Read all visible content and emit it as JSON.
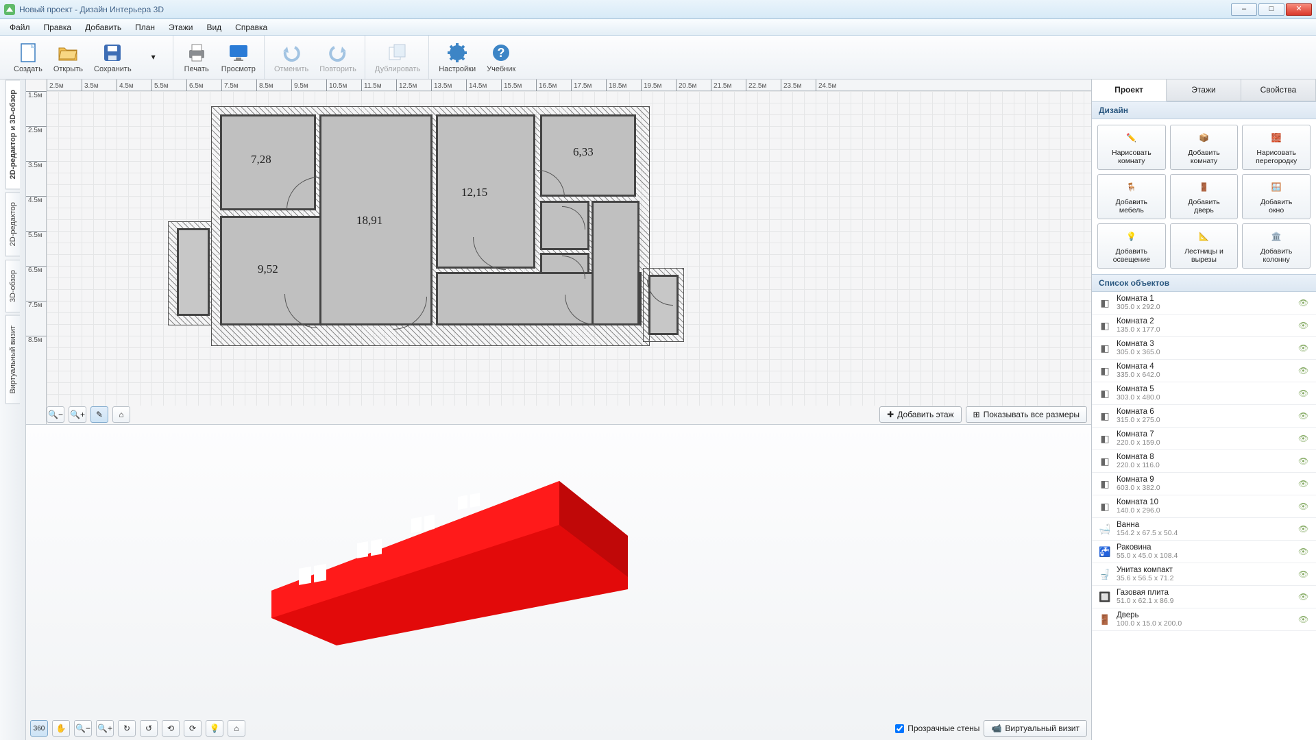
{
  "window": {
    "title": "Новый проект - Дизайн Интерьера 3D"
  },
  "menu": {
    "items": [
      "Файл",
      "Правка",
      "Добавить",
      "План",
      "Этажи",
      "Вид",
      "Справка"
    ]
  },
  "toolbar": {
    "create": "Создать",
    "open": "Открыть",
    "save": "Сохранить",
    "print": "Печать",
    "view": "Просмотр",
    "undo": "Отменить",
    "redo": "Повторить",
    "duplicate": "Дублировать",
    "settings": "Настройки",
    "tutorial": "Учебник"
  },
  "left_tabs": {
    "combo": "2D-редактор и 3D-обзор",
    "editor": "2D-редактор",
    "overview": "3D-обзор",
    "virtual": "Виртуальный визит"
  },
  "ruler_h": [
    "2.5м",
    "3.5м",
    "4.5м",
    "5.5м",
    "6.5м",
    "7.5м",
    "8.5м",
    "9.5м",
    "10.5м",
    "11.5м",
    "12.5м",
    "13.5м",
    "14.5м",
    "15.5м",
    "16.5м",
    "17.5м",
    "18.5м",
    "19.5м",
    "20.5м",
    "21.5м",
    "22.5м",
    "23.5м",
    "24.5м"
  ],
  "ruler_v": [
    "1.5м",
    "2.5м",
    "3.5м",
    "4.5м",
    "5.5м",
    "6.5м",
    "7.5м",
    "8.5м"
  ],
  "rooms": {
    "r1": "7,28",
    "r2": "18,91",
    "r3": "12,15",
    "r4": "6,33",
    "r5": "9,52"
  },
  "canvas_footer": {
    "add_floor": "Добавить этаж",
    "show_dims": "Показывать все размеры"
  },
  "view3d_footer": {
    "transparent_walls": "Прозрачные стены",
    "virtual_visit": "Виртуальный визит"
  },
  "right": {
    "tabs": {
      "project": "Проект",
      "floors": "Этажи",
      "properties": "Свойства"
    },
    "design_header": "Дизайн",
    "grid": {
      "draw_room": "Нарисовать\nкомнату",
      "add_room": "Добавить\nкомнату",
      "draw_partition": "Нарисовать\nперегородку",
      "add_furniture": "Добавить\nмебель",
      "add_door": "Добавить\nдверь",
      "add_window": "Добавить\nокно",
      "add_light": "Добавить\nосвещение",
      "stairs": "Лестницы и\nвырезы",
      "add_column": "Добавить\nколонну"
    },
    "objects_header": "Список объектов",
    "objects": [
      {
        "name": "Комната 1",
        "dim": "305.0 x 292.0",
        "icon": "room"
      },
      {
        "name": "Комната 2",
        "dim": "135.0 x 177.0",
        "icon": "room"
      },
      {
        "name": "Комната 3",
        "dim": "305.0 x 365.0",
        "icon": "room"
      },
      {
        "name": "Комната 4",
        "dim": "335.0 x 642.0",
        "icon": "room"
      },
      {
        "name": "Комната 5",
        "dim": "303.0 x 480.0",
        "icon": "room"
      },
      {
        "name": "Комната 6",
        "dim": "315.0 x 275.0",
        "icon": "room"
      },
      {
        "name": "Комната 7",
        "dim": "220.0 x 159.0",
        "icon": "room"
      },
      {
        "name": "Комната 8",
        "dim": "220.0 x 116.0",
        "icon": "room"
      },
      {
        "name": "Комната 9",
        "dim": "603.0 x 382.0",
        "icon": "room"
      },
      {
        "name": "Комната 10",
        "dim": "140.0 x 296.0",
        "icon": "room"
      },
      {
        "name": "Ванна",
        "dim": "154.2 x 67.5 x 50.4",
        "icon": "bath"
      },
      {
        "name": "Раковина",
        "dim": "55.0 x 45.0 x 108.4",
        "icon": "sink"
      },
      {
        "name": "Унитаз компакт",
        "dim": "35.6 x 56.5 x 71.2",
        "icon": "toilet"
      },
      {
        "name": "Газовая плита",
        "dim": "51.0 x 62.1 x 86.9",
        "icon": "stove"
      },
      {
        "name": "Дверь",
        "dim": "100.0 x 15.0 x 200.0",
        "icon": "door"
      }
    ]
  }
}
